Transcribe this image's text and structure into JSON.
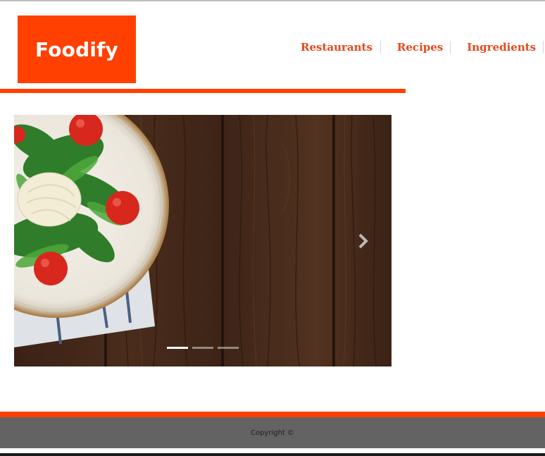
{
  "brand": {
    "name": "Foodify",
    "color": "#ff4000"
  },
  "nav": {
    "items": [
      {
        "label": "Restaurants"
      },
      {
        "label": "Recipes"
      },
      {
        "label": "Ingredients"
      }
    ]
  },
  "carousel": {
    "next_icon": "chevron-right-icon",
    "slide_count": 3,
    "active_slide": 1,
    "slide_image": "salad plate on wooden table"
  },
  "footer": {
    "copyright": "Copyright ©"
  }
}
